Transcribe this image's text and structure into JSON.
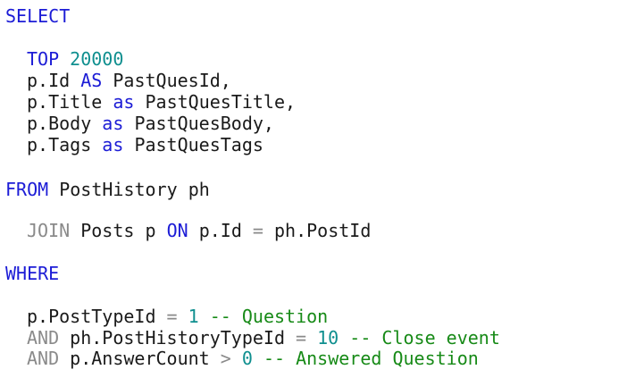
{
  "editor": {
    "lines": {
      "select_kw": "SELECT",
      "top_kw": "TOP",
      "top_num": "20000",
      "col1_expr": "p.Id",
      "col1_as": "AS",
      "col1_alias": "PastQuesId,",
      "col2_expr": "p.Title",
      "col2_as": "as",
      "col2_alias": "PastQuesTitle,",
      "col3_expr": "p.Body",
      "col3_as": "as",
      "col3_alias": "PastQuesBody,",
      "col4_expr": "p.Tags",
      "col4_as": "as",
      "col4_alias": "PastQuesTags",
      "from_kw": "FROM",
      "from_table": "PostHistory ph",
      "join_kw": "JOIN",
      "join_table": "Posts p",
      "on_kw": "ON",
      "on_left": "p.Id",
      "on_op": "=",
      "on_right": "ph.PostId",
      "where_kw": "WHERE",
      "w1_expr": "p.PostTypeId",
      "w1_op": "=",
      "w1_num": "1",
      "w1_comment": "-- Question",
      "w2_and": "AND",
      "w2_expr": "ph.PostHistoryTypeId",
      "w2_op": "=",
      "w2_num": "10",
      "w2_comment": "-- Close event",
      "w3_and": "AND",
      "w3_expr": "p.AnswerCount",
      "w3_op": ">",
      "w3_num": "0",
      "w3_comment": "-- Answered Question"
    },
    "colors": {
      "keyword": "#1c1cd6",
      "number": "#0f8f8f",
      "operator": "#8a8a8a",
      "comment": "#178a17",
      "text": "#1a1a1a",
      "background": "#ffffff"
    }
  }
}
